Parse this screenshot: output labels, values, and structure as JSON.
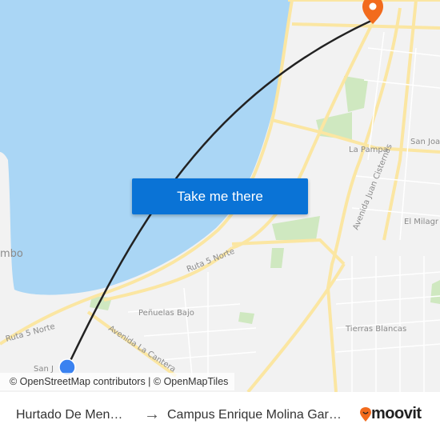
{
  "map": {
    "labels": {
      "la_pampa": "La Pampa",
      "san_joaquin": "San Joa",
      "avenida_juan_cisternas": "Avenida Juan Cisternas",
      "el_milagro": "El Milagr",
      "tierras_blancas": "Tierras Blancas",
      "penuelas_bajo": "Peñuelas Bajo",
      "ruta5_norte_a": "Ruta 5 Norte",
      "ruta5_norte_b": "Ruta 5 Norte",
      "avenida_la_cantera": "Avenida La Cantera",
      "coquimbo": "mbo",
      "san_juan": "San J"
    },
    "colors": {
      "sea": "#aad6f5",
      "land": "#f2f2f2",
      "road": "#fbe6a2",
      "park": "#cfe8c0",
      "route": "#222222",
      "origin": "#3b82f0",
      "destination": "#f26b1d"
    },
    "cta_label": "Take me there",
    "attribution": "© OpenStreetMap contributors | © OpenMapTiles"
  },
  "footer": {
    "origin": "Hurtado De Mendoza",
    "arrow_icon": "arrow-right-icon",
    "destination": "Campus Enrique Molina Garmendia",
    "brand": "moovit",
    "brand_color": "#f26b1d"
  }
}
